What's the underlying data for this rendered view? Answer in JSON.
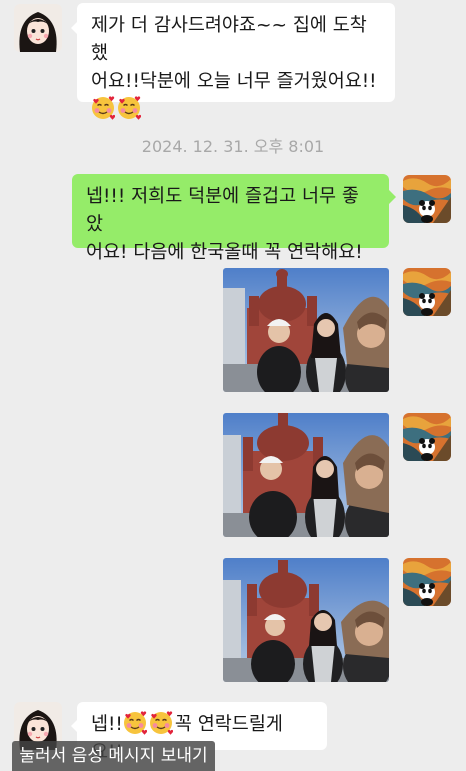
{
  "messages": {
    "m1": {
      "line1": "제가 더 감사드려야죠~~ 집에 도착했",
      "line2": "어요!!닥분에 오늘 너무 즐거웠어요!!",
      "emojis": [
        "smiling-face-with-hearts",
        "smiling-face-with-hearts"
      ]
    },
    "timestamp": "2024. 12. 31. 오후 8:01",
    "m2": {
      "line1": "넵!!! 저희도 덕분에 즐겁고 너무 좋았",
      "line2": "어요! 다음에 한국올때 꼭 연락해요!"
    },
    "photos_count_shown": 3,
    "m3": {
      "prefix": "넵!!",
      "suffix": "꼭 연락드릴게요!!",
      "emojis": [
        "smiling-face-with-hearts",
        "smiling-face-with-hearts"
      ]
    }
  },
  "voice_hint": "눌러서 음성 메시지 보내기",
  "colors": {
    "background": "#ededed",
    "sent_bubble": "#95ec69",
    "received_bubble": "#ffffff"
  },
  "icons": [
    "avatar-friend",
    "avatar-self-scream-panda",
    "smiling-face-with-hearts"
  ]
}
